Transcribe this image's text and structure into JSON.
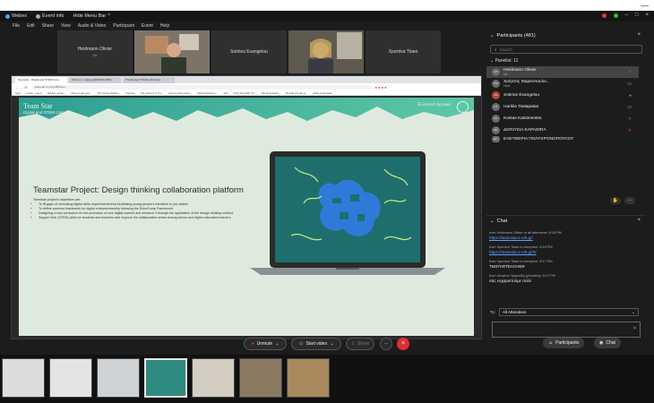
{
  "window": {
    "app_name": "Webex",
    "event_info": "Event info",
    "hide_menu": "Hide Menu Bar"
  },
  "menu": [
    "File",
    "Edit",
    "Share",
    "View",
    "Audio & Video",
    "Participant",
    "Event",
    "Help"
  ],
  "video_tiles": [
    {
      "name": "Heidmann Olivier",
      "sub": "Me",
      "video": false
    },
    {
      "name": "",
      "sub": "",
      "video": true
    },
    {
      "name": "Sotirios Evangelou",
      "sub": "",
      "video": false
    },
    {
      "name": "",
      "sub": "",
      "video": true
    },
    {
      "name": "Χριστίνα Τίακα",
      "sub": "",
      "video": false
    }
  ],
  "browser": {
    "tabs": [
      "Teamstar - Digital and STEM Care...",
      "Inbox (x) - Heykey@STEM-ORM...",
      "The Design Thinking Process"
    ],
    "url": "teamstar.nr.uth.gr/#/home",
    "bookmarks": [
      "Apps",
      "Home - Log in",
      "GitHub - Herer...",
      "https://c-gen.gen...",
      "The Future Worker...",
      "Courses",
      "The Journey to Tru...",
      "List of prime numb...",
      "Optimal Stories c...",
      "web",
      "Unity Test CSF Ch...",
      "Harvard Health...",
      "Moodle 3.5 site fe...",
      "Other bookmarks"
    ]
  },
  "slide": {
    "brand_line1": "Team Star",
    "brand_line2": "Digital and STEM Careers",
    "brand_right": "Ελληνικά  Αγγλικά",
    "title": "Teamstar Project: Design thinking collaboration platform",
    "intro": "Teamstar project's objectives are:",
    "bullets": [
      "To fill gaps of increasing digital skills requirements thus facilitating young people's transition to job market",
      "To define common framework for digital entrepreneurship following the EntreComp Framework",
      "Designing a new curriculum for the promotion of new digital careers and enhance it through the application of the design thinking method",
      "Support tech (STEM) skills for students and teachers and improve the collaborative sense among school and higher education learners"
    ]
  },
  "controls": {
    "unmute": "Unmute",
    "start_video": "Start video",
    "share": "Share",
    "participants": "Participants",
    "chat": "Chat"
  },
  "participants_panel": {
    "title": "Participants (481)",
    "search_placeholder": "Search",
    "panelist_header": "Panelist: 11",
    "panelists": [
      {
        "initials": "HO",
        "name": "Heidmann Olivier",
        "role": "Me",
        "highlight": true
      },
      {
        "initials": "ΧΜ",
        "name": "Χρήστος Μαρκοπουλο...",
        "role": "Host",
        "highlight": false
      },
      {
        "initials": "SE",
        "name": "Sotirios Evangelou",
        "role": "",
        "highlight": false
      },
      {
        "initials": "HT",
        "name": "Harikla Tsalapatas",
        "role": "",
        "highlight": false
      },
      {
        "initials": "KK",
        "name": "Kostas Katsimentes",
        "role": "",
        "highlight": false
      },
      {
        "initials": "ΔΚ",
        "name": "ΔΙΟΝΥΣΙΑ ΚΑΡΑΘΙΠΑ",
        "role": "",
        "highlight": false
      },
      {
        "initials": "ΕΠ",
        "name": "ΕΛΕΥΘΕΡΙΑ ΠΟΛΥΧΡΟΝΟΠΟΥΛΟΥ",
        "role": "",
        "highlight": false
      }
    ]
  },
  "chat_panel": {
    "title": "Chat",
    "messages": [
      {
        "meta": "from Heidmann Olivier to all attendees:   8:16 PM",
        "text": "https://teamstar.e-uth.gr/",
        "link": true
      },
      {
        "meta": "from Χριστίνα Τίακα to everyone:   8:16 PM",
        "text": "https://teamstar.e-uth.gr/#/",
        "link": true
      },
      {
        "meta": "from Χριστίνα Τίακα to everyone:   8:17 PM",
        "text": "TMSTARTEACHER",
        "link": false
      },
      {
        "meta": "from Αστρίνα Ορφανίδη (privately):   8:17 PM",
        "text": "σας ευχαριστούμε πολύ",
        "link": false
      }
    ],
    "to_label": "To:",
    "to_value": "All Attendees"
  },
  "colors": {
    "end_call": "#e02f2f",
    "link": "#5aa0ff",
    "slide_bg": "#dfeadf",
    "slide_header": "#2e9e92"
  }
}
